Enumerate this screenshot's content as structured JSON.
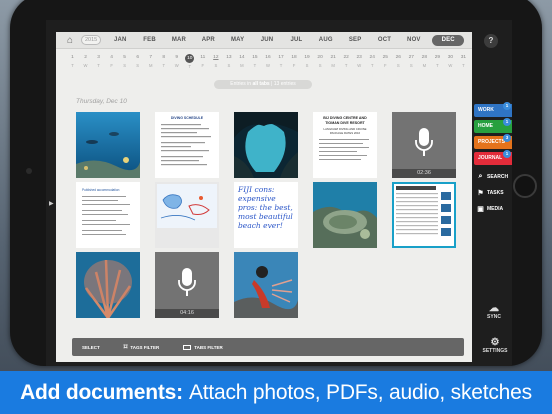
{
  "topbar": {
    "year": "2015",
    "months": [
      "JAN",
      "FEB",
      "MAR",
      "APR",
      "MAY",
      "JUN",
      "JUL",
      "AUG",
      "SEP",
      "OCT",
      "NOV",
      "DEC"
    ],
    "active_month": "DEC"
  },
  "days": [
    {
      "d": "1",
      "w": "T"
    },
    {
      "d": "2",
      "w": "W"
    },
    {
      "d": "3",
      "w": "T"
    },
    {
      "d": "4",
      "w": "F"
    },
    {
      "d": "5",
      "w": "S"
    },
    {
      "d": "6",
      "w": "S"
    },
    {
      "d": "7",
      "w": "M"
    },
    {
      "d": "8",
      "w": "T"
    },
    {
      "d": "9",
      "w": "W"
    },
    {
      "d": "10",
      "w": "T"
    },
    {
      "d": "11",
      "w": "F"
    },
    {
      "d": "12",
      "w": "S"
    },
    {
      "d": "13",
      "w": "S"
    },
    {
      "d": "14",
      "w": "M"
    },
    {
      "d": "15",
      "w": "T"
    },
    {
      "d": "16",
      "w": "W"
    },
    {
      "d": "17",
      "w": "T"
    },
    {
      "d": "18",
      "w": "F"
    },
    {
      "d": "19",
      "w": "S"
    },
    {
      "d": "20",
      "w": "S"
    },
    {
      "d": "21",
      "w": "M"
    },
    {
      "d": "22",
      "w": "T"
    },
    {
      "d": "23",
      "w": "W"
    },
    {
      "d": "24",
      "w": "T"
    },
    {
      "d": "25",
      "w": "F"
    },
    {
      "d": "26",
      "w": "S"
    },
    {
      "d": "27",
      "w": "S"
    },
    {
      "d": "28",
      "w": "M"
    },
    {
      "d": "29",
      "w": "T"
    },
    {
      "d": "30",
      "w": "W"
    },
    {
      "d": "31",
      "w": "T"
    }
  ],
  "entries": {
    "prefix": "Entries in ",
    "scope": "all tabs",
    "sep": " | ",
    "count": "13 entries"
  },
  "date_header": "Thursday, Dec 10",
  "tiles": {
    "doc1_title": "DIVING SCHEDULE",
    "doc2_title": "BIJ DIVING CENTRE AND TIOMAN DIVE RESORT",
    "doc2_sub": "LANGKAWI DIVING AND CRUISE PACKAGE RATES 2016",
    "audio1_time": "02:36",
    "audio2_time": "04:16",
    "note_text": "FIJI cons: expensive pros: the best, most beautiful beach ever!",
    "doc3_title": "Published accommodation"
  },
  "sidebar": {
    "tabs": [
      {
        "label": "WORK",
        "color": "#2f74c4",
        "badge": "1"
      },
      {
        "label": "HOME",
        "color": "#27a03f",
        "badge": "1"
      },
      {
        "label": "PROJECTS",
        "color": "#e4731b",
        "badge": "3"
      },
      {
        "label": "JOURNAL",
        "color": "#e32c3a",
        "badge": "1"
      }
    ],
    "tools": {
      "search": "SEARCH",
      "tasks": "TASKS",
      "media": "MEDIA",
      "sync": "SYNC",
      "settings": "SETTINGS"
    }
  },
  "bottombar": {
    "select": "SELECT",
    "tags_filter": "TAGS FILTER",
    "tabs_filter": "TABS FILTER"
  },
  "caption": {
    "bold": "Add documents:",
    "rest": "Attach photos, PDFs, audio, sketches"
  }
}
